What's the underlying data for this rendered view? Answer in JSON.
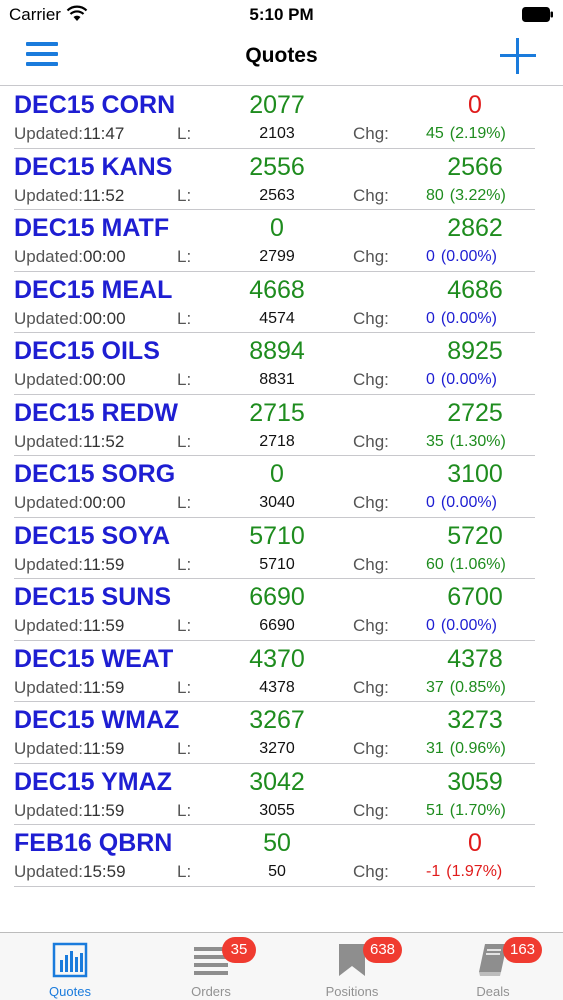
{
  "status_bar": {
    "carrier": "Carrier",
    "time": "5:10 PM"
  },
  "nav": {
    "title": "Quotes"
  },
  "labels": {
    "updated": "Updated:",
    "last": "L:",
    "change": "Chg:"
  },
  "quotes": [
    {
      "symbol": "DEC15 CORN",
      "price": "2077",
      "right": "0",
      "right_color": "red",
      "updated": "11:47",
      "last": "2103",
      "chg": "45",
      "pct": "(2.19%)",
      "chg_color": "green"
    },
    {
      "symbol": "DEC15 KANS",
      "price": "2556",
      "right": "2566",
      "right_color": "green",
      "updated": "11:52",
      "last": "2563",
      "chg": "80",
      "pct": "(3.22%)",
      "chg_color": "green"
    },
    {
      "symbol": "DEC15 MATF",
      "price": "0",
      "right": "2862",
      "right_color": "green",
      "updated": "00:00",
      "last": "2799",
      "chg": "0",
      "pct": "(0.00%)",
      "chg_color": "blue"
    },
    {
      "symbol": "DEC15 MEAL",
      "price": "4668",
      "right": "4686",
      "right_color": "green",
      "updated": "00:00",
      "last": "4574",
      "chg": "0",
      "pct": "(0.00%)",
      "chg_color": "blue"
    },
    {
      "symbol": "DEC15 OILS",
      "price": "8894",
      "right": "8925",
      "right_color": "green",
      "updated": "00:00",
      "last": "8831",
      "chg": "0",
      "pct": "(0.00%)",
      "chg_color": "blue"
    },
    {
      "symbol": "DEC15 REDW",
      "price": "2715",
      "right": "2725",
      "right_color": "green",
      "updated": "11:52",
      "last": "2718",
      "chg": "35",
      "pct": "(1.30%)",
      "chg_color": "green"
    },
    {
      "symbol": "DEC15 SORG",
      "price": "0",
      "right": "3100",
      "right_color": "green",
      "updated": "00:00",
      "last": "3040",
      "chg": "0",
      "pct": "(0.00%)",
      "chg_color": "blue"
    },
    {
      "symbol": "DEC15 SOYA",
      "price": "5710",
      "right": "5720",
      "right_color": "green",
      "updated": "11:59",
      "last": "5710",
      "chg": "60",
      "pct": "(1.06%)",
      "chg_color": "green"
    },
    {
      "symbol": "DEC15 SUNS",
      "price": "6690",
      "right": "6700",
      "right_color": "green",
      "updated": "11:59",
      "last": "6690",
      "chg": "0",
      "pct": "(0.00%)",
      "chg_color": "blue"
    },
    {
      "symbol": "DEC15 WEAT",
      "price": "4370",
      "right": "4378",
      "right_color": "green",
      "updated": "11:59",
      "last": "4378",
      "chg": "37",
      "pct": "(0.85%)",
      "chg_color": "green"
    },
    {
      "symbol": "DEC15 WMAZ",
      "price": "3267",
      "right": "3273",
      "right_color": "green",
      "updated": "11:59",
      "last": "3270",
      "chg": "31",
      "pct": "(0.96%)",
      "chg_color": "green"
    },
    {
      "symbol": "DEC15 YMAZ",
      "price": "3042",
      "right": "3059",
      "right_color": "green",
      "updated": "11:59",
      "last": "3055",
      "chg": "51",
      "pct": "(1.70%)",
      "chg_color": "green"
    },
    {
      "symbol": "FEB16 QBRN",
      "price": "50",
      "right": "0",
      "right_color": "red",
      "updated": "15:59",
      "last": "50",
      "chg": "-1",
      "pct": "(1.97%)",
      "chg_color": "red"
    }
  ],
  "tabs": [
    {
      "label": "Quotes",
      "icon": "bar-chart-icon",
      "badge": "",
      "active": true
    },
    {
      "label": "Orders",
      "icon": "list-icon",
      "badge": "35",
      "active": false
    },
    {
      "label": "Positions",
      "icon": "bookmark-icon",
      "badge": "638",
      "active": false
    },
    {
      "label": "Deals",
      "icon": "book-icon",
      "badge": "163",
      "active": false
    }
  ],
  "colors": {
    "accent": "#1a7bdc",
    "symbol": "#1e1ed2",
    "positive": "#1e8c1e",
    "negative": "#e01b1b",
    "badge": "#f03b30"
  }
}
